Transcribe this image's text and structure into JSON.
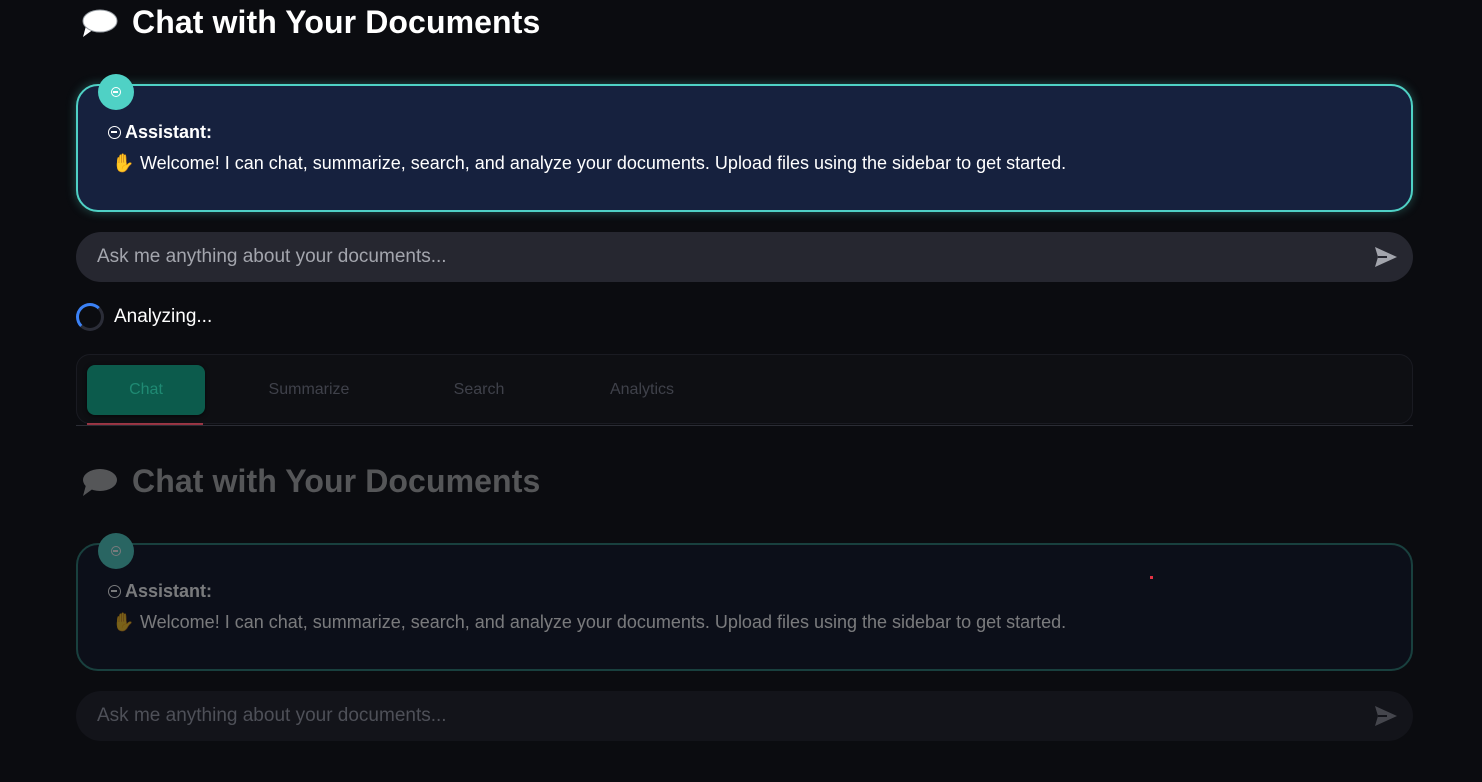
{
  "header": {
    "title": "Chat with Your Documents",
    "icon": "speech-bubble-icon"
  },
  "message": {
    "avatar_icon": "robot-face-icon",
    "role": "Assistant:",
    "wave_icon": "waving-hand-icon",
    "text": "Welcome! I can chat, summarize, search, and analyze your documents. Upload files using the sidebar to get started."
  },
  "chat_input": {
    "placeholder": "Ask me anything about your documents...",
    "send_icon": "send-arrow-icon"
  },
  "status": {
    "text": "Analyzing..."
  },
  "tabs": [
    {
      "label": "Chat",
      "selected": true
    },
    {
      "label": "Summarize",
      "selected": false
    },
    {
      "label": "Search",
      "selected": false
    },
    {
      "label": "Analytics",
      "selected": false
    }
  ],
  "colors": {
    "accent": "#4fd1c5",
    "background": "#0b0c10",
    "card_background": "#16213e",
    "input_background": "#262730",
    "spinner": "#3b82f6",
    "tab_selected": "#0c5b4c"
  }
}
